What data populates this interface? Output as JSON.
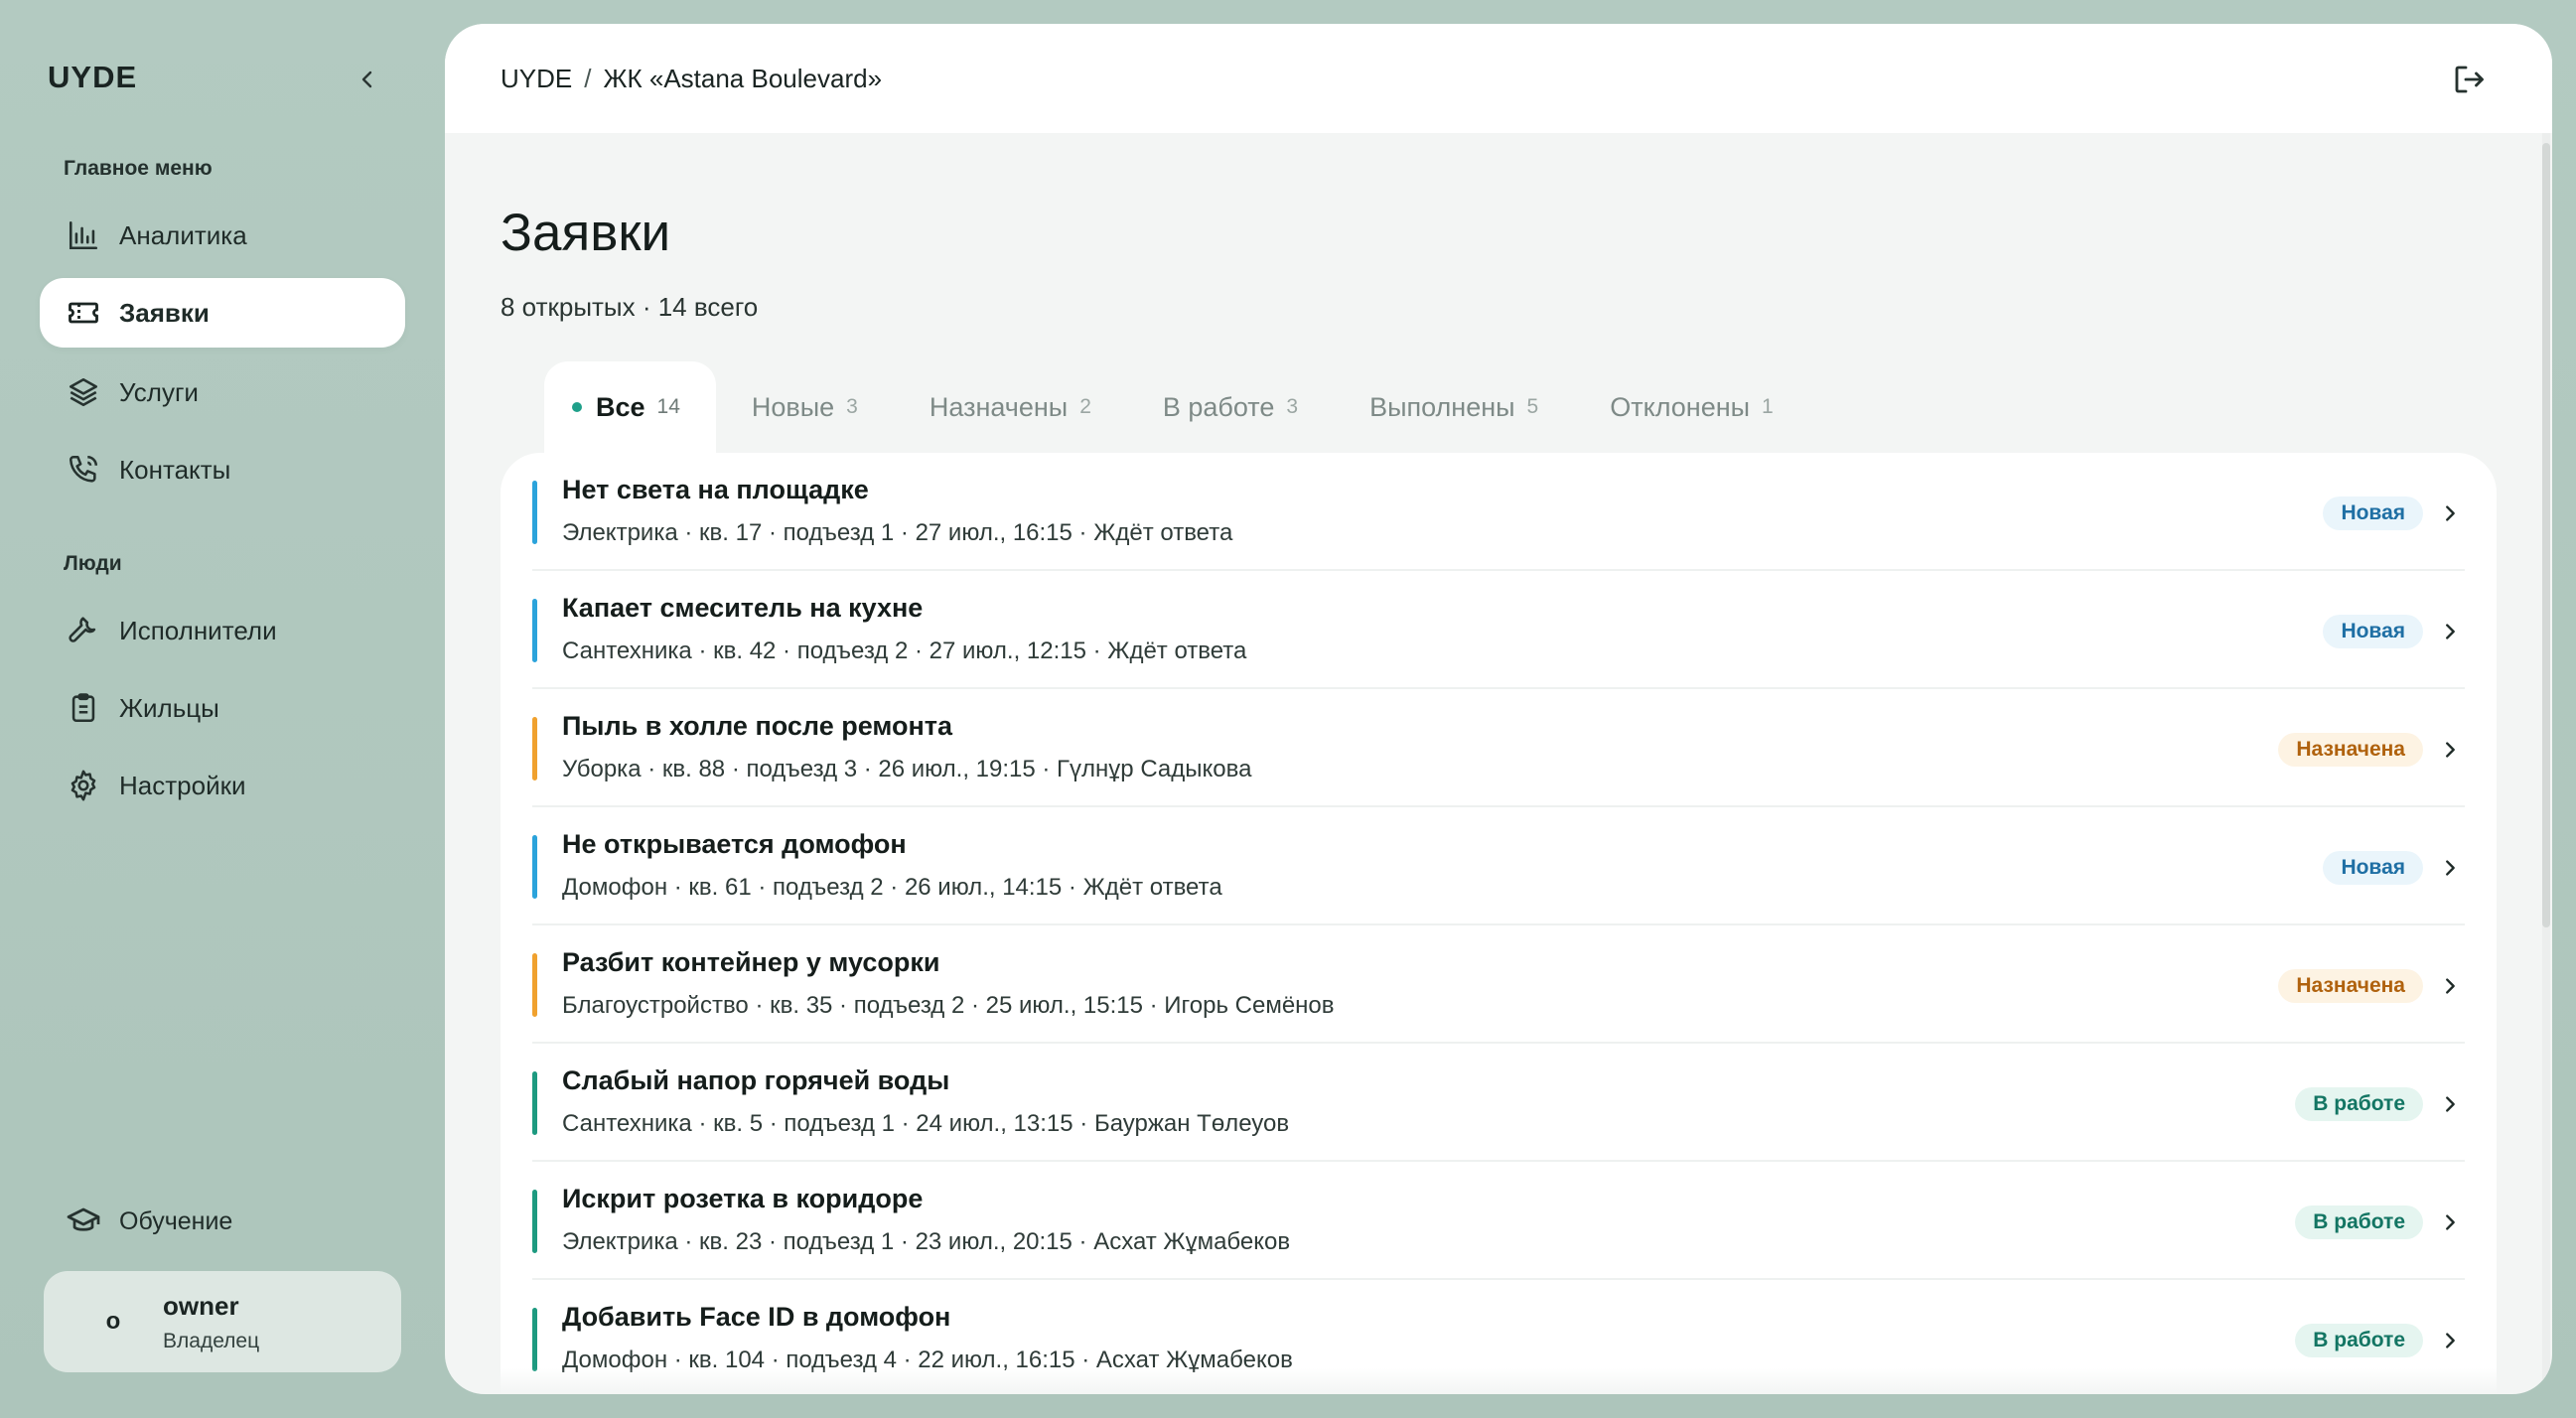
{
  "sidebar": {
    "brand": "UYDE",
    "main_menu_label": "Главное меню",
    "people_label": "Люди",
    "items": [
      {
        "label": "Аналитика",
        "icon": "chart-icon"
      },
      {
        "label": "Заявки",
        "icon": "ticket-icon"
      },
      {
        "label": "Услуги",
        "icon": "layers-icon"
      },
      {
        "label": "Контакты",
        "icon": "phone-icon"
      },
      {
        "label": "Исполнители",
        "icon": "wrench-icon"
      },
      {
        "label": "Жильцы",
        "icon": "clipboard-icon"
      },
      {
        "label": "Настройки",
        "icon": "gear-icon"
      }
    ],
    "training_label": "Обучение",
    "user": {
      "initial": "o",
      "name": "owner",
      "role": "Владелец"
    }
  },
  "header": {
    "breadcrumb": [
      "UYDE",
      "ЖК «Astana Boulevard»"
    ]
  },
  "page": {
    "title": "Заявки",
    "subtitle": "8 открытых · 14 всего"
  },
  "tabs": [
    {
      "label": "Все",
      "count": "14",
      "active": true
    },
    {
      "label": "Новые",
      "count": "3"
    },
    {
      "label": "Назначены",
      "count": "2"
    },
    {
      "label": "В работе",
      "count": "3"
    },
    {
      "label": "Выполнены",
      "count": "5"
    },
    {
      "label": "Отклонены",
      "count": "1"
    }
  ],
  "colors": {
    "new": "#2ba3db",
    "assigned": "#f0a12e",
    "in_progress": "#1d9a80",
    "badge_new_bg": "#eaf5fb",
    "badge_new_fg": "#1f6fa4",
    "badge_assigned_bg": "#fdf3e3",
    "badge_assigned_fg": "#b0620e",
    "badge_progress_bg": "#e5f5f0",
    "badge_progress_fg": "#137563"
  },
  "requests": [
    {
      "title": "Нет света на площадке",
      "meta": "Электрика · кв. 17 · подъезд 1 · 27 июл., 16:15 · Ждёт ответа",
      "status": "Новая",
      "kind": "new"
    },
    {
      "title": "Капает смеситель на кухне",
      "meta": "Сантехника · кв. 42 · подъезд 2 · 27 июл., 12:15 · Ждёт ответа",
      "status": "Новая",
      "kind": "new"
    },
    {
      "title": "Пыль в холле после ремонта",
      "meta": "Уборка · кв. 88 · подъезд 3 · 26 июл., 19:15 · Гүлнұр Садыкова",
      "status": "Назначена",
      "kind": "assigned"
    },
    {
      "title": "Не открывается домофон",
      "meta": "Домофон · кв. 61 · подъезд 2 · 26 июл., 14:15 · Ждёт ответа",
      "status": "Новая",
      "kind": "new"
    },
    {
      "title": "Разбит контейнер у мусорки",
      "meta": "Благоустройство · кв. 35 · подъезд 2 · 25 июл., 15:15 · Игорь Семёнов",
      "status": "Назначена",
      "kind": "assigned"
    },
    {
      "title": "Слабый напор горячей воды",
      "meta": "Сантехника · кв. 5 · подъезд 1 · 24 июл., 13:15 · Бауржан Төлеуов",
      "status": "В работе",
      "kind": "in_progress"
    },
    {
      "title": "Искрит розетка в коридоре",
      "meta": "Электрика · кв. 23 · подъезд 1 · 23 июл., 20:15 · Асхат Жұмабеков",
      "status": "В работе",
      "kind": "in_progress"
    },
    {
      "title": "Добавить Face ID в домофон",
      "meta": "Домофон · кв. 104 · подъезд 4 · 22 июл., 16:15 · Асхат Жұмабеков",
      "status": "В работе",
      "kind": "in_progress"
    }
  ]
}
